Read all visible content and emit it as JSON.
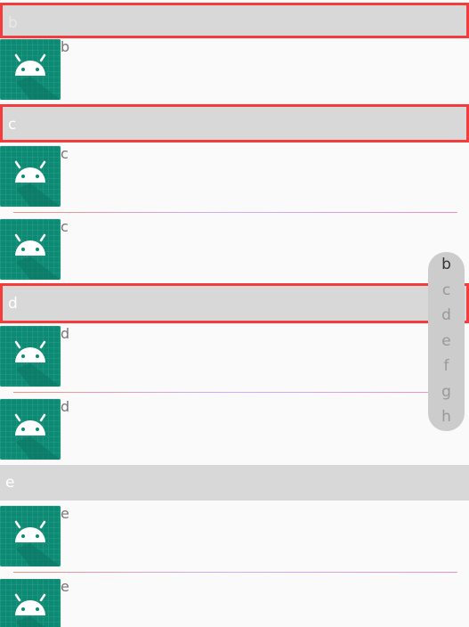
{
  "headers": {
    "b": "b",
    "c": "c",
    "d": "d",
    "e": "e"
  },
  "items": [
    {
      "name": "b"
    },
    {
      "name": "c"
    },
    {
      "name": "c"
    },
    {
      "name": "d"
    },
    {
      "name": "d"
    },
    {
      "name": "e"
    },
    {
      "name": "e"
    }
  ],
  "index_bar": {
    "letters": [
      "b",
      "c",
      "d",
      "e",
      "f",
      "g",
      "h"
    ],
    "active": "b"
  },
  "icons": {
    "avatar": "android-icon"
  },
  "colors": {
    "avatar_bg": "#0d8a74",
    "header_bg": "#d8d8d8",
    "highlight_border": "#f53c3c",
    "index_bar_bg": "#cccccc"
  }
}
